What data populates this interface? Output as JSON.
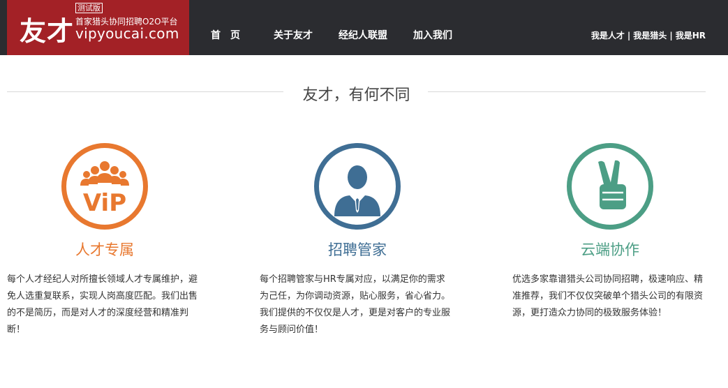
{
  "header": {
    "logo_mark": "友才",
    "logo_beta": "测试版",
    "logo_tagline": "首家猎头协同招聘O2O平台",
    "logo_domain": "vipyoucai.com",
    "nav": [
      {
        "label": "首　页"
      },
      {
        "label": "关于友才"
      },
      {
        "label": "经纪人联盟"
      },
      {
        "label": "加入我们"
      }
    ],
    "user_links": [
      {
        "label": "我是人才"
      },
      {
        "label": "我是猎头"
      },
      {
        "label": "我是HR"
      }
    ],
    "separator": "|"
  },
  "section": {
    "title": "友才，有何不同"
  },
  "features": [
    {
      "title": "人才专属",
      "icon": "vip-people-icon",
      "color": "#e8782f",
      "icon_text": "ViP",
      "desc": "每个人才经纪人对所擅长领域人才专属维护，避免人选重复联系，实现人岗高度匹配。我们出售的不是简历，而是对人才的深度经营和精准判断！"
    },
    {
      "title": "招聘管家",
      "icon": "businessman-icon",
      "color": "#3f6e94",
      "desc": "每个招聘管家与HR专属对应，以满足你的需求为己任，为你调动资源，贴心服务，省心省力。我们提供的不仅仅是人才，更是对客户的专业服务与顾问价值！"
    },
    {
      "title": "云端协作",
      "icon": "victory-hand-icon",
      "color": "#4c9e85",
      "desc": "优选多家靠谱猎头公司协同招聘，极速响应、精准推荐，我们不仅仅突破单个猎头公司的有限资源，更打造众力协同的极致服务体验！"
    }
  ],
  "colors": {
    "header_bg": "#2b2c30",
    "logo_bg": "#a32126"
  }
}
